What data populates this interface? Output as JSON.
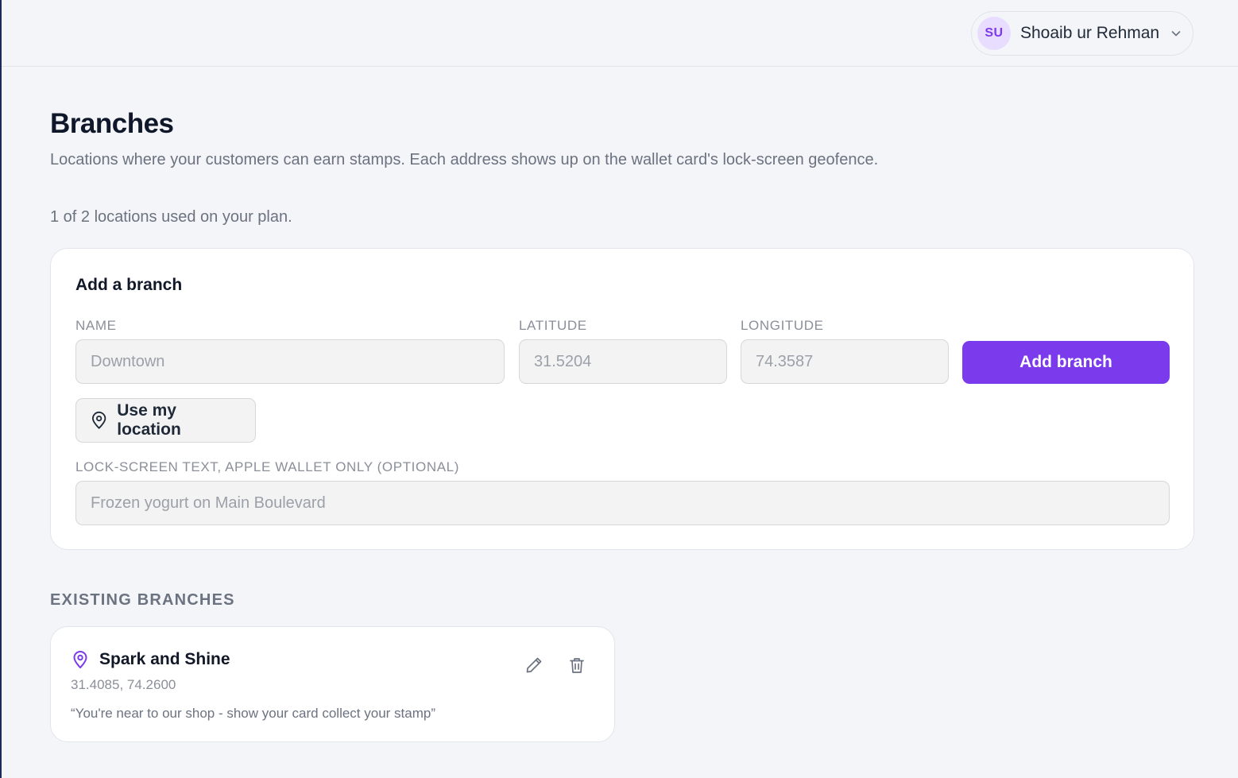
{
  "header": {
    "user": {
      "initials": "SU",
      "name": "Shoaib ur Rehman"
    }
  },
  "page": {
    "title": "Branches",
    "subtitle": "Locations where your customers can earn stamps. Each address shows up on the wallet card's lock-screen geofence.",
    "usage": "1 of 2 locations used on your plan."
  },
  "add_form": {
    "title": "Add a branch",
    "name_label": "NAME",
    "name_placeholder": "Downtown",
    "latitude_label": "LATITUDE",
    "latitude_placeholder": "31.5204",
    "longitude_label": "LONGITUDE",
    "longitude_placeholder": "74.3587",
    "submit_label": "Add branch",
    "use_location_label": "Use my location",
    "lockscreen_label": "LOCK-SCREEN TEXT, APPLE WALLET ONLY (OPTIONAL)",
    "lockscreen_placeholder": "Frozen yogurt on Main Boulevard"
  },
  "existing": {
    "heading": "EXISTING BRANCHES",
    "branches": [
      {
        "name": "Spark and Shine",
        "coords": "31.4085, 74.2600",
        "lockscreen_text": "“You're near to our shop - show your card collect your stamp”"
      }
    ]
  },
  "icons": {
    "user_menu": "chevron-down-icon",
    "use_location": "map-pin-icon",
    "branch": "map-pin-icon",
    "edit": "pencil-icon",
    "delete": "trash-icon"
  },
  "colors": {
    "accent": "#7c3aed",
    "avatar_bg": "#e8ddff",
    "background": "#f4f5f9"
  }
}
